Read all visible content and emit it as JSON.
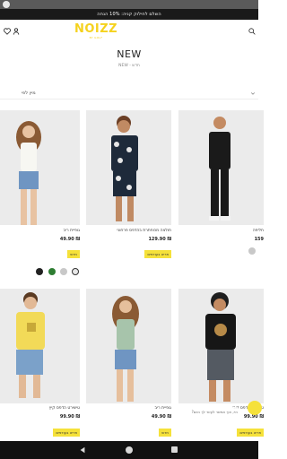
{
  "promo_text": "השלם לחילוק קניה: 10% הנחה",
  "header": {
    "logo_text": "NOIZZ",
    "logo_sub": "BY GOLF"
  },
  "page": {
    "title": "NEW",
    "breadcrumb": "NEW - חדש"
  },
  "filter": {
    "sort_label": "מיין לפי"
  },
  "colors": {
    "accent": "#f5e13a",
    "logo": "#f5d21e"
  },
  "products": [
    {
      "name": "גופיית ריב",
      "price": "49.90 ₪",
      "badge": "חדש"
    },
    {
      "name": "חולצה מכופתרת בהדפס פרחוני",
      "price": "129.90 ₪",
      "badge": "פריט בעודפים"
    },
    {
      "name": "חליפה",
      "price": "159",
      "badge": ""
    },
    {
      "name": "טישירט הדפס קיץ",
      "price": "99.90 ₪",
      "badge": "פריט בעודפים"
    },
    {
      "name": "גופיית ריב",
      "price": "49.90 ₪",
      "badge": "חדש"
    },
    {
      "name": "טישירט הדפס דובי",
      "price": "99.90 ₪",
      "badge": "פריט בעודפים"
    }
  ],
  "swatch_colors": [
    "#222222",
    "#2e7d32",
    "#c8c8c8",
    "#e8e8e8"
  ],
  "chat_tip": "היי, איך אפשר לעזור לך היום?"
}
